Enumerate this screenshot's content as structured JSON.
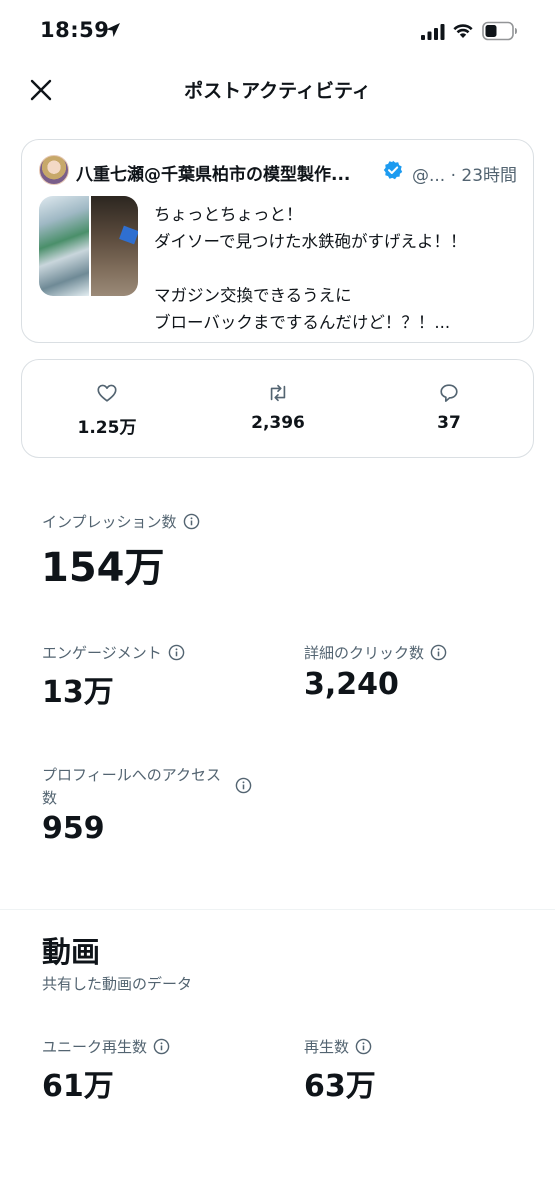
{
  "status_bar": {
    "time": "18:59"
  },
  "header": {
    "title": "ポストアクティビティ"
  },
  "post": {
    "author": "八重七瀬@千葉県柏市の模型製作...",
    "handle_time": "@... · 23時間",
    "text": "ちょっとちょっと！\nダイソーで見つけた水鉄砲がすげえよ！！\n\nマガジン交換できるうえに\nブローバックまでするんだけど！？！..."
  },
  "engagement": {
    "likes": "1.25万",
    "reposts": "2,396",
    "replies": "37"
  },
  "metrics": {
    "impressions": {
      "label": "インプレッション数",
      "value": "154万"
    },
    "engagements": {
      "label": "エンゲージメント",
      "value": "13万"
    },
    "detail_clicks": {
      "label": "詳細のクリック数",
      "value": "3,240"
    },
    "profile_visits": {
      "label": "プロフィールへのアクセス数",
      "value": "959"
    }
  },
  "video": {
    "title": "動画",
    "subtitle": "共有した動画のデータ",
    "unique_views": {
      "label": "ユニーク再生数",
      "value": "61万"
    },
    "views": {
      "label": "再生数",
      "value": "63万"
    }
  }
}
